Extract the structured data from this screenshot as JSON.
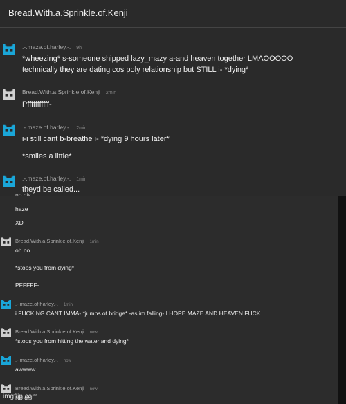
{
  "header": {
    "title": "Bread.With.a.Sprinkle.of.Kenji"
  },
  "top_messages": [
    {
      "author": ".-.maze.of.harley.-.",
      "time": "9h",
      "lines": [
        "*wheezing* s-someone shipped lazy_mazy a-and heaven together LMAOOOOO",
        "technically they are dating cos poly relationship but STILL i- *dying*"
      ]
    },
    {
      "author": "Bread.With.a.Sprinkle.of.Kenji",
      "time": "2min",
      "lines": [
        "Pfffffffffff-"
      ]
    },
    {
      "author": ".-.maze.of.harley.-.",
      "time": "2min",
      "lines": [
        "i-i still cant b-breathe i- *dying 9 hours later*",
        "*smiles a little*"
      ]
    },
    {
      "author": ".-.maze.of.harley.-.",
      "time": "1min",
      "lines": [
        "theyd be called..."
      ]
    }
  ],
  "lower": {
    "cut_text": "no dis",
    "loose_lines": [
      "haze",
      "XD"
    ],
    "messages": [
      {
        "author": "Bread.With.a.Sprinkle.of.Kenji",
        "time": "1min",
        "lines": [
          "oh no",
          "*stops you from dying*",
          "PFFFFF-"
        ]
      },
      {
        "author": ".-.maze.of.harley.-.",
        "time": "1min",
        "lines": [
          "i FUCKING CANT IMMA- *jumps of bridge* -as im falling- I HOPE MAZE AND HEAVEN FUCK"
        ]
      },
      {
        "author": "Bread.With.a.Sprinkle.of.Kenji",
        "time": "now",
        "lines": [
          "*stops you from hitting the water and dying*"
        ]
      },
      {
        "author": ".-.maze.of.harley.-.",
        "time": "now",
        "lines": [
          "awwww"
        ]
      },
      {
        "author": "Bread.With.a.Sprinkle.of.Kenji",
        "time": "now",
        "lines": [
          "No dis"
        ]
      }
    ]
  },
  "watermark": "imgflip.com",
  "colors": {
    "maze_avatar": "#1aa6d8",
    "kenji_avatar": "#cfcfcf",
    "background": "#2a2a2a"
  },
  "icons": {
    "maze_avatar": "blue-invader-avatar-icon",
    "kenji_avatar": "grey-invader-avatar-icon"
  }
}
